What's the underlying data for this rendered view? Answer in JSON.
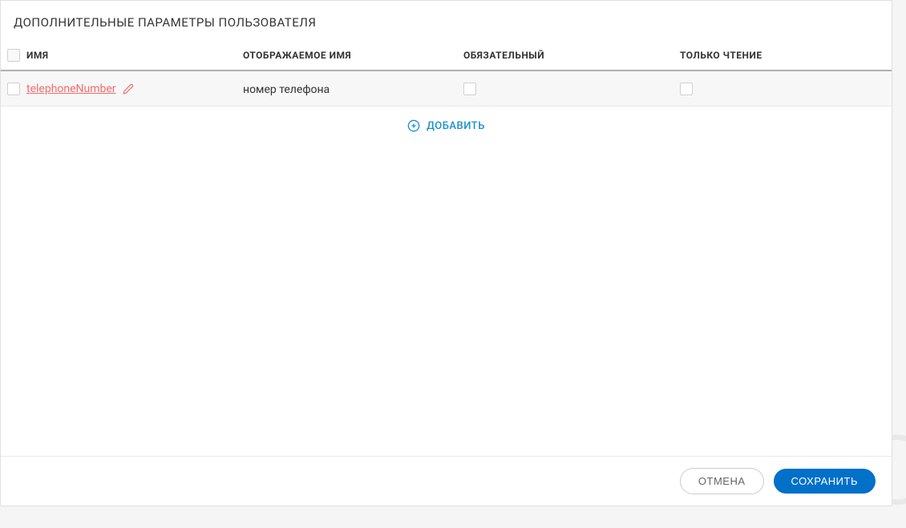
{
  "header": {
    "title": "ДОПОЛНИТЕЛЬНЫЕ ПАРАМЕТРЫ ПОЛЬЗОВАТЕЛЯ"
  },
  "table": {
    "columns": {
      "name": "ИМЯ",
      "display": "ОТОБРАЖАЕМОЕ ИМЯ",
      "required": "ОБЯЗАТЕЛЬНЫЙ",
      "readonly": "ТОЛЬКО ЧТЕНИЕ"
    },
    "rows": [
      {
        "name": "telephoneNumber",
        "display": "номер телефона",
        "required": false,
        "readonly": false
      }
    ]
  },
  "actions": {
    "add": "ДОБАВИТЬ",
    "cancel": "ОТМЕНА",
    "save": "СОХРАНИТЬ"
  }
}
